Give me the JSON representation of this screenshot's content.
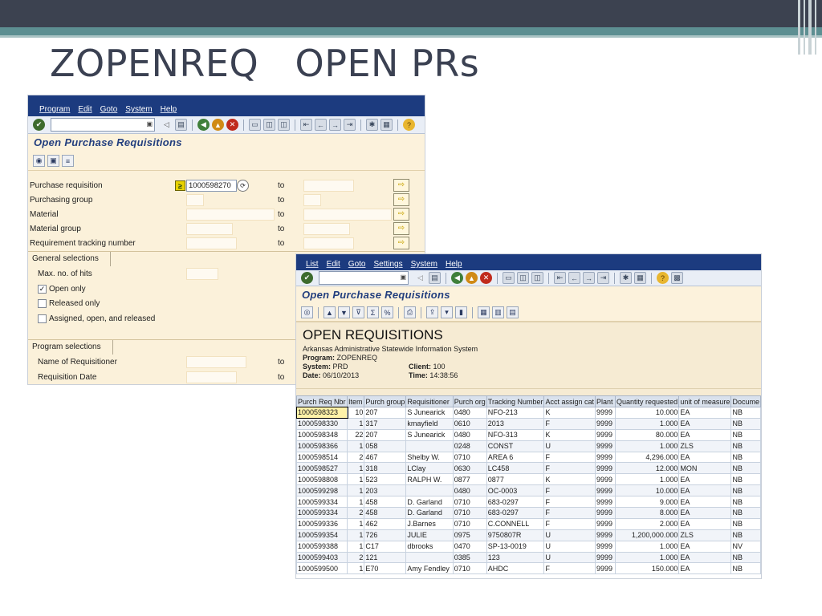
{
  "slide": {
    "title": "ZOPENREQ   OPEN PRs"
  },
  "sap_menu": [
    "Program",
    "Edit",
    "Goto",
    "System",
    "Help"
  ],
  "results_menu": [
    "List",
    "Edit",
    "Goto",
    "Settings",
    "System",
    "Help"
  ],
  "selection_screen": {
    "title": "Open Purchase Requisitions",
    "fields": [
      {
        "label": "Purchase requisition",
        "low": "1000598270",
        "to": "to"
      },
      {
        "label": "Purchasing group",
        "low": "",
        "to": "to"
      },
      {
        "label": "Material",
        "low": "",
        "to": "to"
      },
      {
        "label": "Material group",
        "low": "",
        "to": "to"
      },
      {
        "label": "Requirement tracking number",
        "low": "",
        "to": "to"
      }
    ],
    "general_group": {
      "title": "General selections",
      "max_hits_label": "Max. no. of hits",
      "options": [
        {
          "label": "Open only",
          "checked": true
        },
        {
          "label": "Released only",
          "checked": false
        },
        {
          "label": "Assigned, open, and released",
          "checked": false
        }
      ]
    },
    "program_group": {
      "title": "Program selections",
      "fields": [
        {
          "label": "Name of Requisitioner",
          "to": "to"
        },
        {
          "label": "Requisition  Date",
          "to": "to"
        }
      ]
    }
  },
  "results_screen": {
    "title": "Open Purchase Requisitions",
    "report": {
      "heading": "OPEN REQUISITIONS",
      "subtitle": "Arkansas Administrative Statewide Information System",
      "program_label": "Program:",
      "program": "ZOPENREQ",
      "system_label": "System:",
      "system": "PRD",
      "client_label": "Client:",
      "client": "100",
      "date_label": "Date:",
      "date": "06/10/2013",
      "time_label": "Time:",
      "time": "14:38:56"
    },
    "columns": [
      "Purch Req Nbr",
      "Item",
      "Purch group",
      "Requisitioner",
      "Purch org",
      "Tracking Number",
      "Acct assign cat",
      "Plant",
      "Quantity requested",
      "unit of measure",
      "Docume"
    ],
    "rows": [
      [
        "1000598323",
        "10",
        "207",
        "S Junearick",
        "0480",
        "NFO-213",
        "K",
        "9999",
        "10.000",
        "EA",
        "NB"
      ],
      [
        "1000598330",
        "1",
        "317",
        "kmayfield",
        "0610",
        "2013",
        "F",
        "9999",
        "1.000",
        "EA",
        "NB"
      ],
      [
        "1000598348",
        "22",
        "207",
        "S Junearick",
        "0480",
        "NFO-313",
        "K",
        "9999",
        "80.000",
        "EA",
        "NB"
      ],
      [
        "1000598366",
        "1",
        "058",
        "",
        "0248",
        "CONST",
        "U",
        "9999",
        "1.000",
        "ZLS",
        "NB"
      ],
      [
        "1000598514",
        "2",
        "467",
        "Shelby W.",
        "0710",
        "AREA 6",
        "F",
        "9999",
        "4,296.000",
        "EA",
        "NB"
      ],
      [
        "1000598527",
        "1",
        "318",
        "LClay",
        "0630",
        "LC458",
        "F",
        "9999",
        "12.000",
        "MON",
        "NB"
      ],
      [
        "1000598808",
        "1",
        "523",
        "RALPH W.",
        "0877",
        "0877",
        "K",
        "9999",
        "1.000",
        "EA",
        "NB"
      ],
      [
        "1000599298",
        "1",
        "203",
        "",
        "0480",
        "OC-0003",
        "F",
        "9999",
        "10.000",
        "EA",
        "NB"
      ],
      [
        "1000599334",
        "1",
        "458",
        "D. Garland",
        "0710",
        "683-0297",
        "F",
        "9999",
        "9.000",
        "EA",
        "NB"
      ],
      [
        "1000599334",
        "2",
        "458",
        "D. Garland",
        "0710",
        "683-0297",
        "F",
        "9999",
        "8.000",
        "EA",
        "NB"
      ],
      [
        "1000599336",
        "1",
        "462",
        "J.Barnes",
        "0710",
        "C.CONNELL",
        "F",
        "9999",
        "2.000",
        "EA",
        "NB"
      ],
      [
        "1000599354",
        "1",
        "726",
        "JULIE",
        "0975",
        "9750807R",
        "U",
        "9999",
        "1,200,000.000",
        "ZLS",
        "NB"
      ],
      [
        "1000599388",
        "1",
        "C17",
        "dbrooks",
        "0470",
        "SP-13-0019",
        "U",
        "9999",
        "1.000",
        "EA",
        "NV"
      ],
      [
        "1000599403",
        "2",
        "121",
        "",
        "0385",
        "123",
        "U",
        "9999",
        "1.000",
        "EA",
        "NB"
      ],
      [
        "1000599500",
        "1",
        "E70",
        "Amy Fendley",
        "0710",
        "AHDC",
        "F",
        "9999",
        "150.000",
        "EA",
        "NB"
      ]
    ]
  }
}
